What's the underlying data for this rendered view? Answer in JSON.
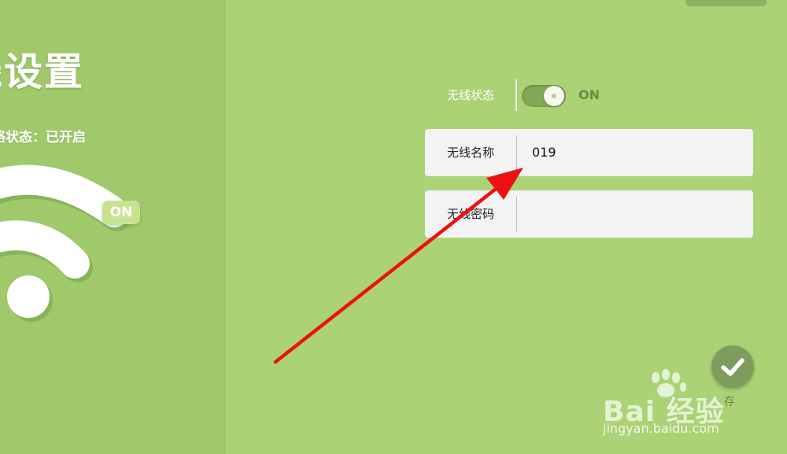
{
  "left_panel": {
    "title": "线设置",
    "network_status": "络状态：已开启",
    "badge_label": "ON"
  },
  "wireless": {
    "status_label": "无线状态",
    "toggle_state": "ON",
    "name_label": "无线名称",
    "name_value": "019",
    "password_label": "无线密码",
    "password_value": ""
  },
  "actions": {
    "save_icon": "check-icon",
    "save_label": "存"
  },
  "watermark": {
    "brand": "Bai 经验",
    "url": "jingyan.baidu.com"
  },
  "colors": {
    "background": "#abd275",
    "left_panel": "#a0c96b",
    "annotation_arrow": "#ee1111"
  }
}
